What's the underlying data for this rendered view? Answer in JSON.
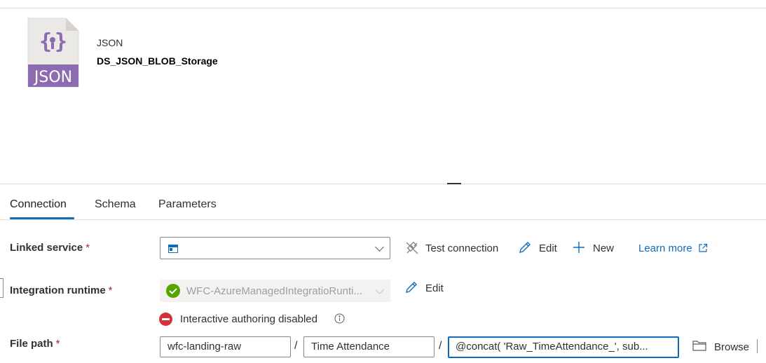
{
  "dataset": {
    "icon_label": "JSON",
    "type": "JSON",
    "name": "DS_JSON_BLOB_Storage"
  },
  "tabs": [
    {
      "label": "Connection",
      "active": true
    },
    {
      "label": "Schema",
      "active": false
    },
    {
      "label": "Parameters",
      "active": false
    }
  ],
  "linked_service": {
    "label": "Linked service",
    "required_mark": "*",
    "value": "",
    "actions": {
      "test_connection": "Test connection",
      "edit": "Edit",
      "new": "New",
      "learn_more": "Learn more"
    }
  },
  "integration_runtime": {
    "label": "Integration runtime",
    "required_mark": "*",
    "value": "WFC-AzureManagedIntegratioRunti...",
    "edit": "Edit",
    "warning": "Interactive authoring disabled"
  },
  "file_path": {
    "label": "File path",
    "required_mark": "*",
    "container": "wfc-landing-raw",
    "directory": "Time Attendance",
    "file": "@concat( 'Raw_TimeAttendance_', sub...",
    "separator": "/",
    "browse": "Browse"
  },
  "colors": {
    "accent": "#0f6cbd",
    "json_icon": "#8c6bb1",
    "success": "#57a300",
    "error": "#d13438"
  }
}
